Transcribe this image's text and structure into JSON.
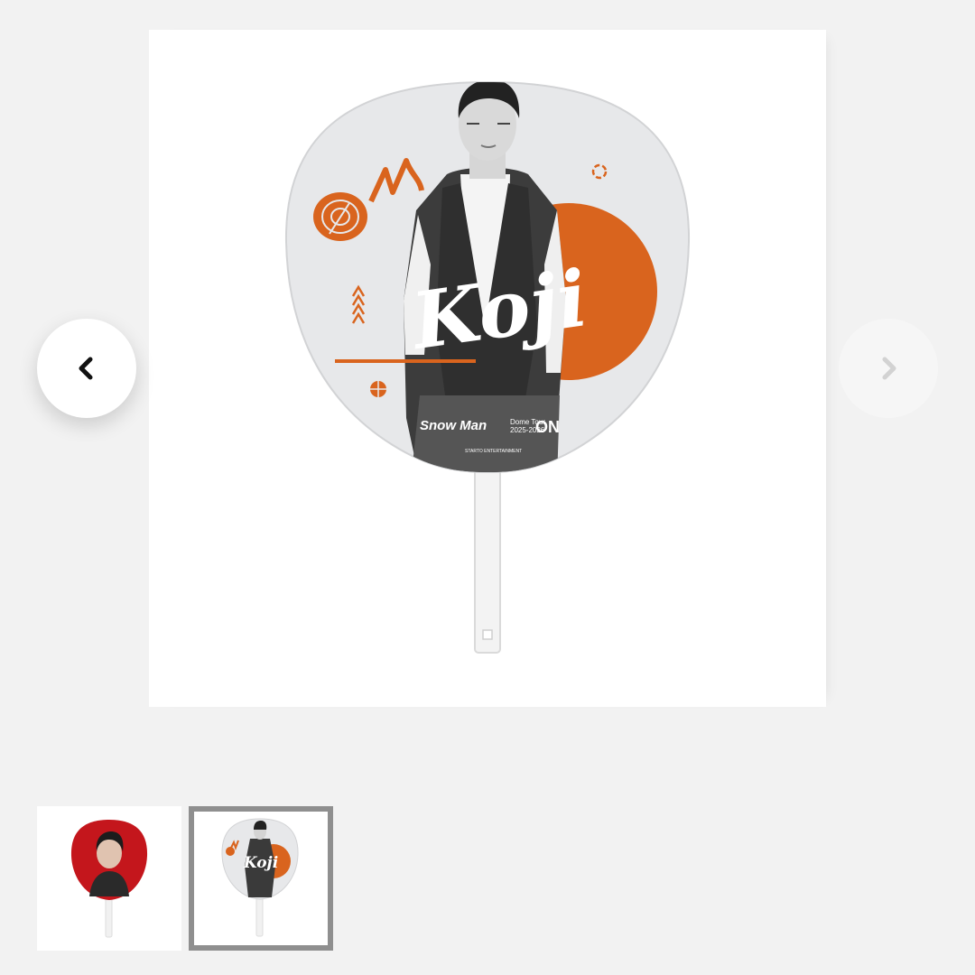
{
  "gallery": {
    "main_image": {
      "name_script": "Koji",
      "logo_text": "Snow Man",
      "tour_line1": "Dome Tour",
      "tour_line2": "2025-2026",
      "tour_suffix": "ON",
      "credit": "STARTO ENTERTAINMENT"
    },
    "prev_button": {
      "icon": "chevron-left-icon",
      "enabled": true
    },
    "next_button": {
      "icon": "chevron-right-icon",
      "enabled": false
    },
    "thumbnails": [
      {
        "variant": "red",
        "selected": false
      },
      {
        "variant": "koji-orange",
        "selected": true,
        "label": "Koji"
      }
    ]
  },
  "colors": {
    "page_bg": "#f2f2f2",
    "accent_orange": "#d9641e",
    "thumb_red": "#c4161c",
    "selected_border": "#8f8f8f"
  }
}
